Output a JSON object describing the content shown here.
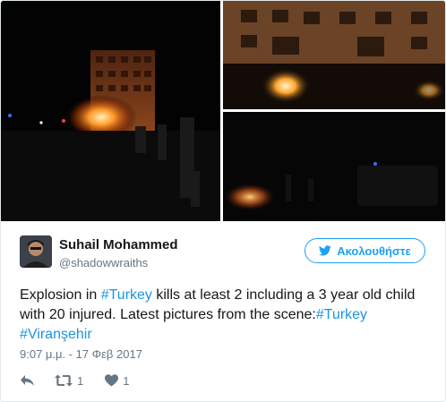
{
  "tweet": {
    "user": {
      "name": "Suhail Mohammed",
      "handle": "@shadowwraiths"
    },
    "follow_label": "Ακολουθήστε",
    "text": {
      "part1": "Explosion in ",
      "hashtag1": "#Turkey",
      "part2": " kills at least 2 including a 3 year old child with 20 injured. Latest pictures from the scene:",
      "hashtag2": "#Turkey",
      "hashtag3": "#Viranşehir"
    },
    "timestamp": "9:07 μ.μ. - 17 Φεβ 2017",
    "actions": {
      "retweet_count": "1",
      "like_count": "1"
    }
  },
  "icons": {
    "follow": "twitter-bird-icon",
    "reply": "reply-icon",
    "retweet": "retweet-icon",
    "like": "heart-icon"
  },
  "colors": {
    "accent": "#1da1f2",
    "link": "#1b95e0",
    "muted": "#657786",
    "text": "#14171a",
    "border": "#e1e8ed"
  }
}
